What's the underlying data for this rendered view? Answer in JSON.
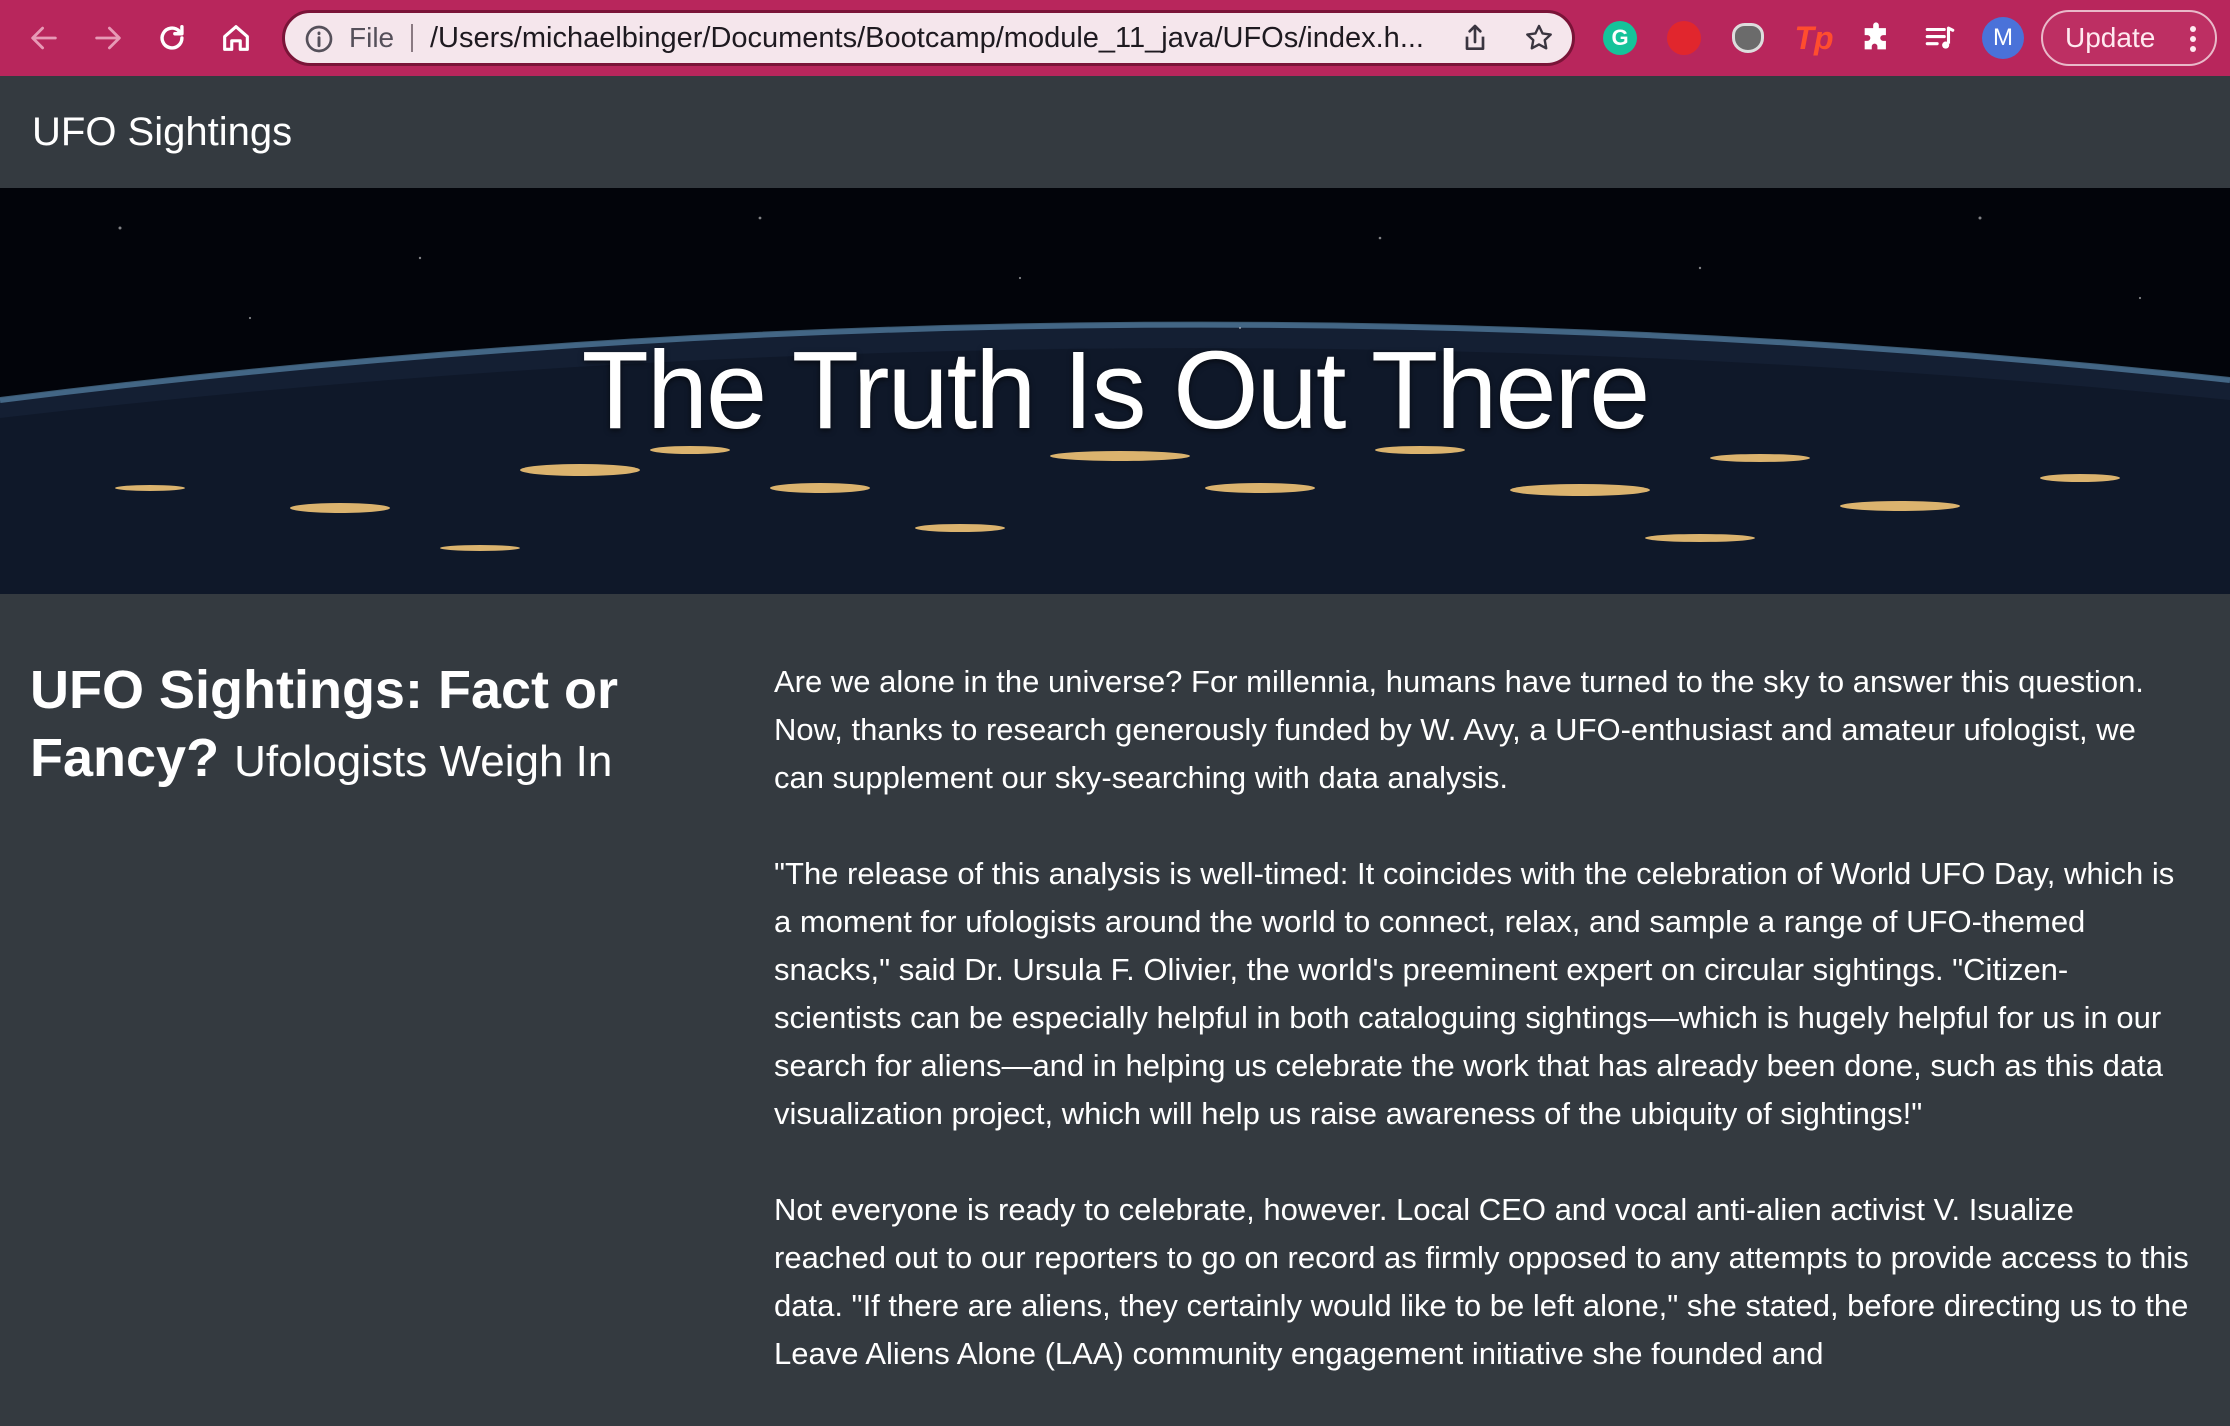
{
  "browser": {
    "file_label": "File",
    "url": "/Users/michaelbinger/Documents/Bootcamp/module_11_java/UFOs/index.h...",
    "extensions": {
      "grammarly_letter": "G",
      "tp_label": "Tp"
    },
    "avatar_letter": "M",
    "update_label": "Update"
  },
  "navbar": {
    "brand": "UFO Sightings"
  },
  "hero": {
    "title": "The Truth Is Out There"
  },
  "lead": {
    "title": "UFO Sightings: Fact or Fancy?",
    "subtitle": "Ufologists Weigh In"
  },
  "article": {
    "paragraphs": [
      "Are we alone in the universe? For millennia, humans have turned to the sky to answer this question. Now, thanks to research generously funded by W. Avy, a UFO-enthusiast and amateur ufologist, we can supplement our sky-searching with data analysis.",
      "\"The release of this analysis is well-timed: It coincides with the celebration of World UFO Day, which is a moment for ufologists around the world to connect, relax, and sample a range of UFO-themed snacks,\" said Dr. Ursula F. Olivier, the world's preeminent expert on circular sightings. \"Citizen-scientists can be especially helpful in both cataloguing sightings—which is hugely helpful for us in our search for aliens—and in helping us celebrate the work that has already been done, such as this data visualization project, which will help us raise awareness of the ubiquity of sightings!\"",
      "Not everyone is ready to celebrate, however. Local CEO and vocal anti-alien activist V. Isualize reached out to our reporters to go on record as firmly opposed to any attempts to provide access to this data. \"If there are aliens, they certainly would like to be left alone,\" she stated, before directing us to the Leave Aliens Alone (LAA) community engagement initiative she founded and"
    ]
  },
  "colors": {
    "browser_bar": "#b8265c",
    "page_background": "#343a40",
    "text": "#ffffff"
  }
}
